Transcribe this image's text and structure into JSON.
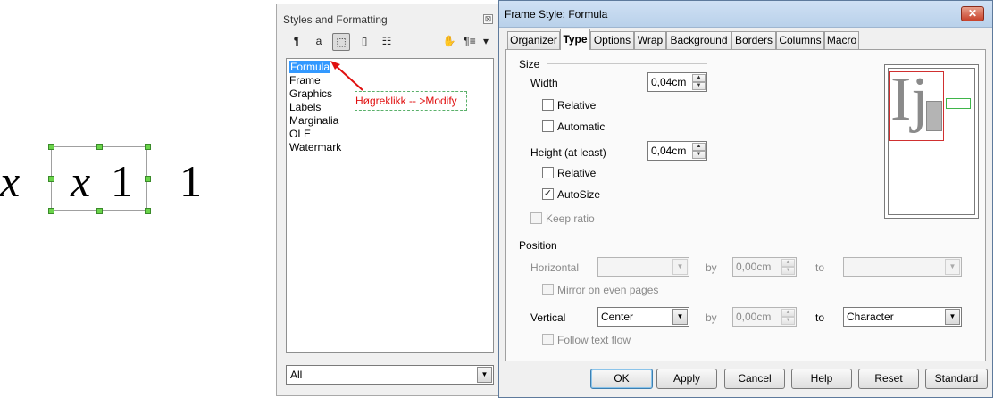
{
  "formula": {
    "glyphs": [
      "x",
      "x",
      "1",
      "1"
    ]
  },
  "styles_panel": {
    "title": "Styles and Formatting",
    "close_glyph": "⊠",
    "toolbar": {
      "paragraph_styles_icon": "¶",
      "character_styles_icon": "a",
      "frame_styles_icon": "⬚",
      "page_styles_icon": "▯",
      "list_styles_icon": "☷",
      "fill_format_icon": "✋",
      "new_style_icon": "¶≡",
      "menu_arrow": "▾"
    },
    "items": [
      "Formula",
      "Frame",
      "Graphics",
      "Labels",
      "Marginalia",
      "OLE",
      "Watermark"
    ],
    "selected_item": "Formula",
    "annotation": "Høgreklikk -- >Modify",
    "filter_value": "All"
  },
  "dialog": {
    "title": "Frame Style: Formula",
    "close_glyph": "✕",
    "tabs": [
      "Organizer",
      "Type",
      "Options",
      "Wrap",
      "Background",
      "Borders",
      "Columns",
      "Macro"
    ],
    "active_tab": "Type",
    "size": {
      "section_label": "Size",
      "width_label": "Width",
      "width_value": "0,04cm",
      "relative_label": "Relative",
      "automatic_label": "Automatic",
      "height_label": "Height (at least)",
      "height_value": "0,04cm",
      "relative2_label": "Relative",
      "autosize_label": "AutoSize",
      "autosize_checked": true,
      "keep_ratio_label": "Keep ratio"
    },
    "position": {
      "section_label": "Position",
      "horizontal_label": "Horizontal",
      "horizontal_value": "",
      "by_label": "by",
      "by_value": "0,00cm",
      "to_label": "to",
      "to_value": "",
      "mirror_label": "Mirror on even pages",
      "vertical_label": "Vertical",
      "vertical_value": "Center",
      "by2_label": "by",
      "by2_value": "0,00cm",
      "to2_label": "to",
      "to2_value": "Character",
      "follow_label": "Follow text flow"
    },
    "preview_text": "Ij",
    "buttons": {
      "ok": "OK",
      "apply": "Apply",
      "cancel": "Cancel",
      "help": "Help",
      "reset": "Reset",
      "standard": "Standard"
    },
    "check_glyph": "✓",
    "spin_up_glyph": "▲",
    "spin_down_glyph": "▼",
    "combo_glyph": "▼"
  },
  "colors": {
    "selection_highlight": "#3399ff",
    "annotation_text": "#e01010",
    "handle_fill": "#6ad44a"
  }
}
